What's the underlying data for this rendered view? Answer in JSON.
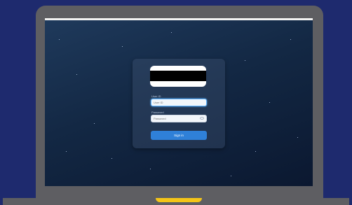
{
  "login": {
    "userid_label": "User ID",
    "userid_placeholder": "User ID",
    "password_label": "Password",
    "password_placeholder": "Password",
    "signin_label": "Sign in"
  },
  "colors": {
    "background": "#1e2a6e",
    "laptop_frame": "#5e5e62",
    "accent_button": "#2f80d8",
    "notch": "#f5c518",
    "input_focus": "#5eb3ff"
  }
}
